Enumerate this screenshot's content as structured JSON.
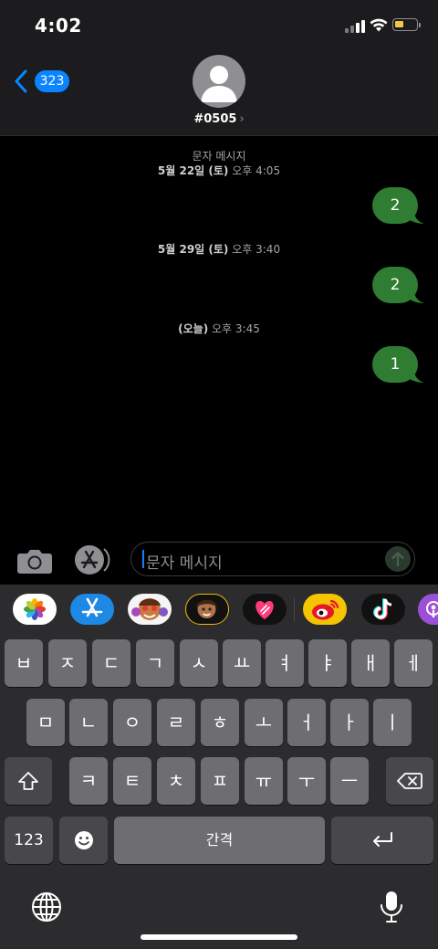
{
  "status": {
    "time": "4:02",
    "battery_color": "#f4c542"
  },
  "header": {
    "back_count": "323",
    "contact": "#0505",
    "contact_chevron": "›"
  },
  "conversation": {
    "sections": [
      {
        "label": "문자 메시지",
        "date_bold": "5월 22일 (토)",
        "time": "오후 4:05",
        "message": "2"
      },
      {
        "date_bold": "5월 29일 (토)",
        "time": "오후 3:40",
        "message": "2"
      },
      {
        "date_bold": "(오늘)",
        "time": "오후 3:45",
        "message": "1"
      }
    ],
    "bubble_color": "#2e7d32"
  },
  "input": {
    "placeholder": "문자 메시지"
  },
  "apps": [
    "photos-icon",
    "app-store-icon",
    "memoji-stickers-icon",
    "memoji-icon",
    "digital-touch-icon",
    "weibo-icon",
    "tiktok-icon",
    "podcasts-icon"
  ],
  "keyboard": {
    "row1": [
      "ㅂ",
      "ㅈ",
      "ㄷ",
      "ㄱ",
      "ㅅ",
      "ㅛ",
      "ㅕ",
      "ㅑ",
      "ㅐ",
      "ㅔ"
    ],
    "row2": [
      "ㅁ",
      "ㄴ",
      "ㅇ",
      "ㄹ",
      "ㅎ",
      "ㅗ",
      "ㅓ",
      "ㅏ",
      "ㅣ"
    ],
    "row3": [
      "ㅋ",
      "ㅌ",
      "ㅊ",
      "ㅍ",
      "ㅠ",
      "ㅜ",
      "ㅡ"
    ],
    "numbers_label": "123",
    "space_label": "간격"
  }
}
